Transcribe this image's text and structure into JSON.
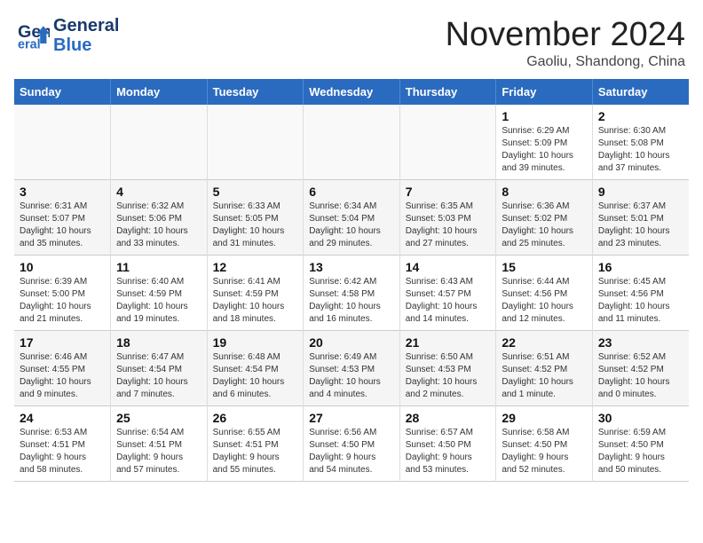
{
  "header": {
    "logo_line1": "General",
    "logo_line2": "Blue",
    "month_year": "November 2024",
    "location": "Gaoliu, Shandong, China"
  },
  "weekdays": [
    "Sunday",
    "Monday",
    "Tuesday",
    "Wednesday",
    "Thursday",
    "Friday",
    "Saturday"
  ],
  "weeks": [
    [
      {
        "day": "",
        "info": ""
      },
      {
        "day": "",
        "info": ""
      },
      {
        "day": "",
        "info": ""
      },
      {
        "day": "",
        "info": ""
      },
      {
        "day": "",
        "info": ""
      },
      {
        "day": "1",
        "info": "Sunrise: 6:29 AM\nSunset: 5:09 PM\nDaylight: 10 hours\nand 39 minutes."
      },
      {
        "day": "2",
        "info": "Sunrise: 6:30 AM\nSunset: 5:08 PM\nDaylight: 10 hours\nand 37 minutes."
      }
    ],
    [
      {
        "day": "3",
        "info": "Sunrise: 6:31 AM\nSunset: 5:07 PM\nDaylight: 10 hours\nand 35 minutes."
      },
      {
        "day": "4",
        "info": "Sunrise: 6:32 AM\nSunset: 5:06 PM\nDaylight: 10 hours\nand 33 minutes."
      },
      {
        "day": "5",
        "info": "Sunrise: 6:33 AM\nSunset: 5:05 PM\nDaylight: 10 hours\nand 31 minutes."
      },
      {
        "day": "6",
        "info": "Sunrise: 6:34 AM\nSunset: 5:04 PM\nDaylight: 10 hours\nand 29 minutes."
      },
      {
        "day": "7",
        "info": "Sunrise: 6:35 AM\nSunset: 5:03 PM\nDaylight: 10 hours\nand 27 minutes."
      },
      {
        "day": "8",
        "info": "Sunrise: 6:36 AM\nSunset: 5:02 PM\nDaylight: 10 hours\nand 25 minutes."
      },
      {
        "day": "9",
        "info": "Sunrise: 6:37 AM\nSunset: 5:01 PM\nDaylight: 10 hours\nand 23 minutes."
      }
    ],
    [
      {
        "day": "10",
        "info": "Sunrise: 6:39 AM\nSunset: 5:00 PM\nDaylight: 10 hours\nand 21 minutes."
      },
      {
        "day": "11",
        "info": "Sunrise: 6:40 AM\nSunset: 4:59 PM\nDaylight: 10 hours\nand 19 minutes."
      },
      {
        "day": "12",
        "info": "Sunrise: 6:41 AM\nSunset: 4:59 PM\nDaylight: 10 hours\nand 18 minutes."
      },
      {
        "day": "13",
        "info": "Sunrise: 6:42 AM\nSunset: 4:58 PM\nDaylight: 10 hours\nand 16 minutes."
      },
      {
        "day": "14",
        "info": "Sunrise: 6:43 AM\nSunset: 4:57 PM\nDaylight: 10 hours\nand 14 minutes."
      },
      {
        "day": "15",
        "info": "Sunrise: 6:44 AM\nSunset: 4:56 PM\nDaylight: 10 hours\nand 12 minutes."
      },
      {
        "day": "16",
        "info": "Sunrise: 6:45 AM\nSunset: 4:56 PM\nDaylight: 10 hours\nand 11 minutes."
      }
    ],
    [
      {
        "day": "17",
        "info": "Sunrise: 6:46 AM\nSunset: 4:55 PM\nDaylight: 10 hours\nand 9 minutes."
      },
      {
        "day": "18",
        "info": "Sunrise: 6:47 AM\nSunset: 4:54 PM\nDaylight: 10 hours\nand 7 minutes."
      },
      {
        "day": "19",
        "info": "Sunrise: 6:48 AM\nSunset: 4:54 PM\nDaylight: 10 hours\nand 6 minutes."
      },
      {
        "day": "20",
        "info": "Sunrise: 6:49 AM\nSunset: 4:53 PM\nDaylight: 10 hours\nand 4 minutes."
      },
      {
        "day": "21",
        "info": "Sunrise: 6:50 AM\nSunset: 4:53 PM\nDaylight: 10 hours\nand 2 minutes."
      },
      {
        "day": "22",
        "info": "Sunrise: 6:51 AM\nSunset: 4:52 PM\nDaylight: 10 hours\nand 1 minute."
      },
      {
        "day": "23",
        "info": "Sunrise: 6:52 AM\nSunset: 4:52 PM\nDaylight: 10 hours\nand 0 minutes."
      }
    ],
    [
      {
        "day": "24",
        "info": "Sunrise: 6:53 AM\nSunset: 4:51 PM\nDaylight: 9 hours\nand 58 minutes."
      },
      {
        "day": "25",
        "info": "Sunrise: 6:54 AM\nSunset: 4:51 PM\nDaylight: 9 hours\nand 57 minutes."
      },
      {
        "day": "26",
        "info": "Sunrise: 6:55 AM\nSunset: 4:51 PM\nDaylight: 9 hours\nand 55 minutes."
      },
      {
        "day": "27",
        "info": "Sunrise: 6:56 AM\nSunset: 4:50 PM\nDaylight: 9 hours\nand 54 minutes."
      },
      {
        "day": "28",
        "info": "Sunrise: 6:57 AM\nSunset: 4:50 PM\nDaylight: 9 hours\nand 53 minutes."
      },
      {
        "day": "29",
        "info": "Sunrise: 6:58 AM\nSunset: 4:50 PM\nDaylight: 9 hours\nand 52 minutes."
      },
      {
        "day": "30",
        "info": "Sunrise: 6:59 AM\nSunset: 4:50 PM\nDaylight: 9 hours\nand 50 minutes."
      }
    ]
  ]
}
